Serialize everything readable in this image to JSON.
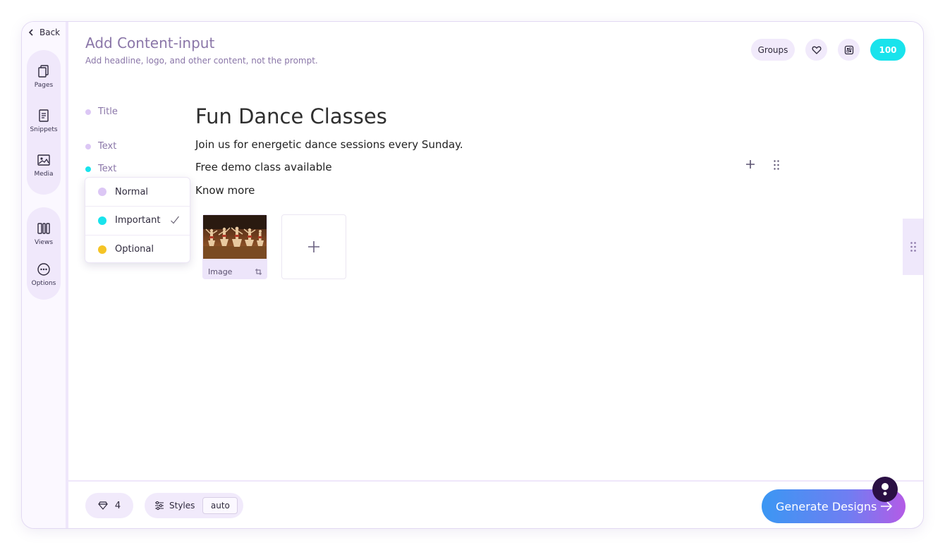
{
  "nav": {
    "back_label": "Back"
  },
  "rail": {
    "pages_label": "Pages",
    "snippets_label": "Snippets",
    "media_label": "Media",
    "views_label": "Views",
    "options_label": "Options"
  },
  "header": {
    "title": "Add Content-input",
    "subtitle": "Add headline, logo, and other content, not the prompt.",
    "groups_label": "Groups",
    "credits": "100"
  },
  "labels": {
    "title": "Title",
    "text1": "Text",
    "text2": "Text"
  },
  "priority_dropdown": {
    "options": [
      {
        "label": "Normal",
        "color": "#dcc7f5"
      },
      {
        "label": "Important",
        "color": "#19e3ec"
      },
      {
        "label": "Optional",
        "color": "#f5c425"
      }
    ],
    "selected": "Important"
  },
  "content": {
    "title": "Fun Dance Classes",
    "line1": "Join us for energetic dance sessions every Sunday.",
    "line2": "Free demo class available",
    "line3": "Know more"
  },
  "media": {
    "image_caption": "Image"
  },
  "footer": {
    "credits_count": "4",
    "styles_label": "Styles",
    "styles_value": "auto",
    "generate_label": "Generate Designs"
  },
  "colors": {
    "accent": "#8a76a8",
    "credits_badge": "#19e3ec",
    "rail_bg": "#f0e8fb",
    "dot_title": "#dcc7f5",
    "dot_text_normal": "#dcc7f5",
    "dot_text_important": "#19e3ec"
  }
}
